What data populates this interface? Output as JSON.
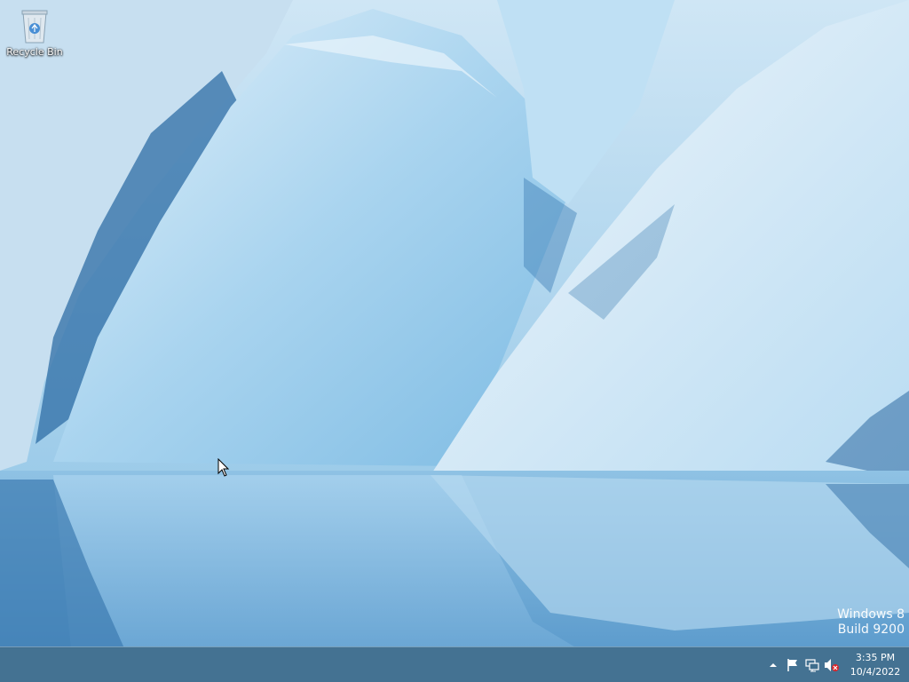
{
  "desktop": {
    "icons": [
      {
        "label": "Recycle Bin",
        "icon": "recycle-bin-icon"
      }
    ],
    "watermark": {
      "line1": "Windows 8",
      "line2": "Build 9200"
    }
  },
  "taskbar": {
    "tray": {
      "show_hidden_icon": "chevron-up-icon",
      "action_center_icon": "flag-icon",
      "network_icon": "network-icon",
      "volume_icon": "volume-muted-icon",
      "clock": {
        "time": "3:35 PM",
        "date": "10/4/2022"
      }
    }
  },
  "colors": {
    "taskbar": "#3f6d8c",
    "ice_light": "#d9ecf7",
    "ice_mid": "#8cc3e6",
    "ice_dark": "#2f6ea6"
  }
}
